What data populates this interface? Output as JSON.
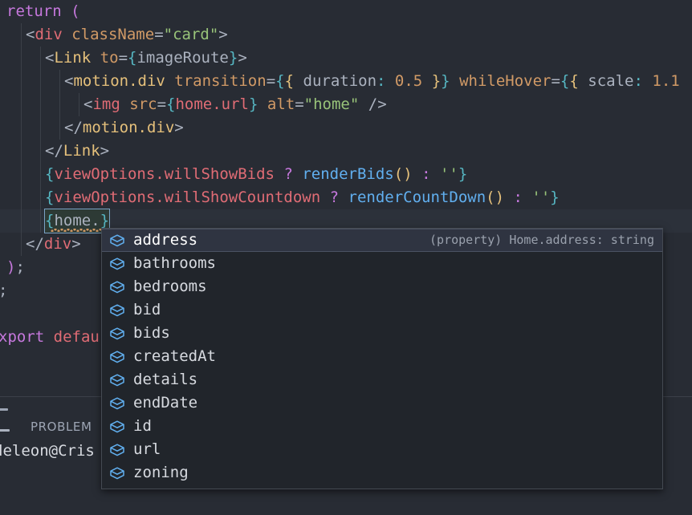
{
  "editor": {
    "language": "jsx",
    "lines": [
      {
        "id": "l1",
        "indent": 0,
        "guides": 0,
        "current": false,
        "tokens": [
          {
            "c": "t-kw",
            "s": "return"
          },
          {
            "c": "t-plain",
            "s": " "
          },
          {
            "c": "t-kw",
            "s": "("
          }
        ]
      },
      {
        "id": "l2",
        "indent": 1,
        "guides": 1,
        "current": false,
        "tokens": [
          {
            "c": "t-punc",
            "s": "<"
          },
          {
            "c": "t-tag",
            "s": "div"
          },
          {
            "c": "t-plain",
            "s": " "
          },
          {
            "c": "t-attr",
            "s": "className"
          },
          {
            "c": "t-plain",
            "s": "="
          },
          {
            "c": "t-str",
            "s": "\"card\""
          },
          {
            "c": "t-punc",
            "s": ">"
          }
        ]
      },
      {
        "id": "l3",
        "indent": 2,
        "guides": 2,
        "current": false,
        "tokens": [
          {
            "c": "t-punc",
            "s": "<"
          },
          {
            "c": "t-comp",
            "s": "Link"
          },
          {
            "c": "t-plain",
            "s": " "
          },
          {
            "c": "t-attr",
            "s": "to"
          },
          {
            "c": "t-plain",
            "s": "="
          },
          {
            "c": "t-brace",
            "s": "{"
          },
          {
            "c": "t-plain",
            "s": "imageRoute"
          },
          {
            "c": "t-brace",
            "s": "}"
          },
          {
            "c": "t-punc",
            "s": ">"
          }
        ]
      },
      {
        "id": "l4",
        "indent": 3,
        "guides": 3,
        "current": false,
        "tokens": [
          {
            "c": "t-punc",
            "s": "<"
          },
          {
            "c": "t-comp",
            "s": "motion.div"
          },
          {
            "c": "t-plain",
            "s": " "
          },
          {
            "c": "t-attr",
            "s": "transition"
          },
          {
            "c": "t-plain",
            "s": "="
          },
          {
            "c": "t-brace",
            "s": "{"
          },
          {
            "c": "t-yellow",
            "s": "{"
          },
          {
            "c": "t-plain",
            "s": " "
          },
          {
            "c": "t-plain",
            "s": "duration"
          },
          {
            "c": "t-brace",
            "s": ":"
          },
          {
            "c": "t-plain",
            "s": " "
          },
          {
            "c": "t-num",
            "s": "0.5"
          },
          {
            "c": "t-plain",
            "s": " "
          },
          {
            "c": "t-yellow",
            "s": "}"
          },
          {
            "c": "t-brace",
            "s": "}"
          },
          {
            "c": "t-plain",
            "s": " "
          },
          {
            "c": "t-attr",
            "s": "whileHover"
          },
          {
            "c": "t-plain",
            "s": "="
          },
          {
            "c": "t-brace",
            "s": "{"
          },
          {
            "c": "t-yellow",
            "s": "{"
          },
          {
            "c": "t-plain",
            "s": " "
          },
          {
            "c": "t-plain",
            "s": "scale"
          },
          {
            "c": "t-brace",
            "s": ":"
          },
          {
            "c": "t-plain",
            "s": " "
          },
          {
            "c": "t-num",
            "s": "1.1"
          }
        ]
      },
      {
        "id": "l5",
        "indent": 4,
        "guides": 4,
        "current": false,
        "tokens": [
          {
            "c": "t-punc",
            "s": "<"
          },
          {
            "c": "t-tag",
            "s": "img"
          },
          {
            "c": "t-plain",
            "s": " "
          },
          {
            "c": "t-attr",
            "s": "src"
          },
          {
            "c": "t-plain",
            "s": "="
          },
          {
            "c": "t-brace",
            "s": "{"
          },
          {
            "c": "t-prop",
            "s": "home.url"
          },
          {
            "c": "t-brace",
            "s": "}"
          },
          {
            "c": "t-plain",
            "s": " "
          },
          {
            "c": "t-attr",
            "s": "alt"
          },
          {
            "c": "t-plain",
            "s": "="
          },
          {
            "c": "t-str",
            "s": "\"home\""
          },
          {
            "c": "t-plain",
            "s": " "
          },
          {
            "c": "t-punc",
            "s": "/>"
          }
        ]
      },
      {
        "id": "l6",
        "indent": 3,
        "guides": 3,
        "current": false,
        "tokens": [
          {
            "c": "t-punc",
            "s": "</"
          },
          {
            "c": "t-comp",
            "s": "motion.div"
          },
          {
            "c": "t-punc",
            "s": ">"
          }
        ]
      },
      {
        "id": "l7",
        "indent": 2,
        "guides": 2,
        "current": false,
        "tokens": [
          {
            "c": "t-punc",
            "s": "</"
          },
          {
            "c": "t-comp",
            "s": "Link"
          },
          {
            "c": "t-punc",
            "s": ">"
          }
        ]
      },
      {
        "id": "l8",
        "indent": 2,
        "guides": 2,
        "current": false,
        "tokens": [
          {
            "c": "t-brace",
            "s": "{"
          },
          {
            "c": "t-prop",
            "s": "viewOptions.willShowBids"
          },
          {
            "c": "t-plain",
            "s": " "
          },
          {
            "c": "t-kw",
            "s": "?"
          },
          {
            "c": "t-plain",
            "s": " "
          },
          {
            "c": "t-blue",
            "s": "renderBids"
          },
          {
            "c": "t-yellow",
            "s": "()"
          },
          {
            "c": "t-plain",
            "s": " "
          },
          {
            "c": "t-kw",
            "s": ":"
          },
          {
            "c": "t-plain",
            "s": " "
          },
          {
            "c": "t-str",
            "s": "''"
          },
          {
            "c": "t-brace",
            "s": "}"
          }
        ]
      },
      {
        "id": "l9",
        "indent": 2,
        "guides": 2,
        "current": false,
        "tokens": [
          {
            "c": "t-brace",
            "s": "{"
          },
          {
            "c": "t-prop",
            "s": "viewOptions.willShowCountdown"
          },
          {
            "c": "t-plain",
            "s": " "
          },
          {
            "c": "t-kw",
            "s": "?"
          },
          {
            "c": "t-plain",
            "s": " "
          },
          {
            "c": "t-blue",
            "s": "renderCountDown"
          },
          {
            "c": "t-yellow",
            "s": "()"
          },
          {
            "c": "t-plain",
            "s": " "
          },
          {
            "c": "t-kw",
            "s": ":"
          },
          {
            "c": "t-plain",
            "s": " "
          },
          {
            "c": "t-str",
            "s": "''"
          },
          {
            "c": "t-brace",
            "s": "}"
          }
        ]
      },
      {
        "id": "l10",
        "indent": 2,
        "guides": 2,
        "current": true,
        "selection": true,
        "tokens": [
          {
            "c": "t-brace",
            "s": "{"
          },
          {
            "c": "t-plain",
            "s": "home."
          },
          {
            "c": "t-brace",
            "s": "}"
          }
        ]
      },
      {
        "id": "l11",
        "indent": 1,
        "guides": 1,
        "current": false,
        "tokens": [
          {
            "c": "t-punc",
            "s": "</"
          },
          {
            "c": "t-tag",
            "s": "div"
          },
          {
            "c": "t-punc",
            "s": ">"
          }
        ]
      },
      {
        "id": "l12",
        "indent": 0,
        "guides": 0,
        "current": false,
        "tokens": [
          {
            "c": "t-kw",
            "s": ")"
          },
          {
            "c": "t-plain",
            "s": ";"
          }
        ]
      },
      {
        "id": "l13",
        "indent": -1,
        "guides": 0,
        "current": false,
        "tokens": [
          {
            "c": "t-plain",
            "s": ";"
          }
        ]
      },
      {
        "id": "l14",
        "indent": 0,
        "guides": 0,
        "current": false,
        "tokens": []
      },
      {
        "id": "l15",
        "indent": -1,
        "guides": 0,
        "current": false,
        "tokens": [
          {
            "c": "t-kw",
            "s": "xport"
          },
          {
            "c": "t-plain",
            "s": " "
          },
          {
            "c": "t-tag",
            "s": "defau"
          }
        ]
      }
    ]
  },
  "autocomplete": {
    "icon_name": "property-cube-icon",
    "icon_color": "#61afef",
    "selected_index": 0,
    "items": [
      {
        "label": "address",
        "detail": "(property) Home.address: string",
        "icon": "property-cube-icon"
      },
      {
        "label": "bathrooms",
        "detail": "",
        "icon": "property-cube-icon"
      },
      {
        "label": "bedrooms",
        "detail": "",
        "icon": "property-cube-icon"
      },
      {
        "label": "bid",
        "detail": "",
        "icon": "property-cube-icon"
      },
      {
        "label": "bids",
        "detail": "",
        "icon": "property-cube-icon"
      },
      {
        "label": "createdAt",
        "detail": "",
        "icon": "property-cube-icon"
      },
      {
        "label": "details",
        "detail": "",
        "icon": "property-cube-icon"
      },
      {
        "label": "endDate",
        "detail": "",
        "icon": "property-cube-icon"
      },
      {
        "label": "id",
        "detail": "",
        "icon": "property-cube-icon"
      },
      {
        "label": "url",
        "detail": "",
        "icon": "property-cube-icon"
      },
      {
        "label": "zoning",
        "detail": "",
        "icon": "property-cube-icon"
      }
    ]
  },
  "panel": {
    "tab_label": "PROBLEM",
    "terminal_line": "deleon@Cris"
  },
  "colors": {
    "editor_bg": "#282c34",
    "current_line_bg": "#2c313a",
    "popup_bg": "#21252b",
    "popup_selected_bg": "#2f3441",
    "popup_border": "#454a52",
    "accent_blue": "#61afef",
    "keyword_purple": "#c678dd",
    "tag_red": "#e06c75",
    "string_green": "#98c379",
    "component_yellow": "#e5c07b",
    "attr_orange": "#d19a66",
    "error_squiggle": "#d19a66",
    "text_default": "#abb2bf"
  }
}
